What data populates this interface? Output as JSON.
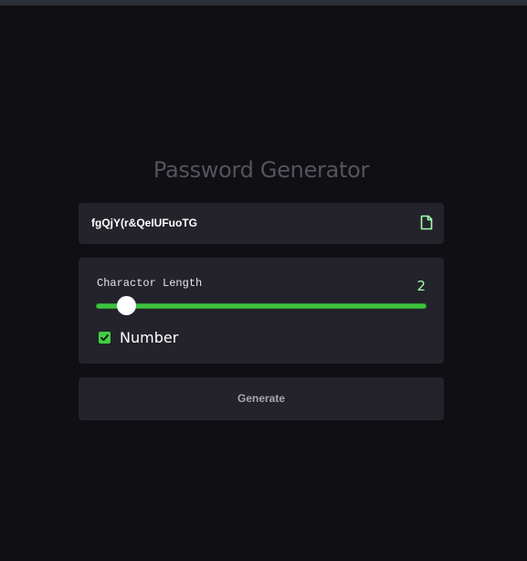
{
  "app": {
    "title": "Password Generator"
  },
  "password": {
    "value": "fgQjY(r&QeIUFuoTG",
    "copy_icon": "copy-file-icon"
  },
  "settings": {
    "length_label": "Charactor Length",
    "length_value": "2",
    "slider_fraction": 0.09,
    "checkbox_label": "Number",
    "checkbox_checked": true
  },
  "actions": {
    "generate_label": "Generate"
  },
  "colors": {
    "background": "#0f0f14",
    "panel": "#24232b",
    "accent": "#3ec23e",
    "value_green": "#a4ffaf",
    "title": "#55535c"
  }
}
